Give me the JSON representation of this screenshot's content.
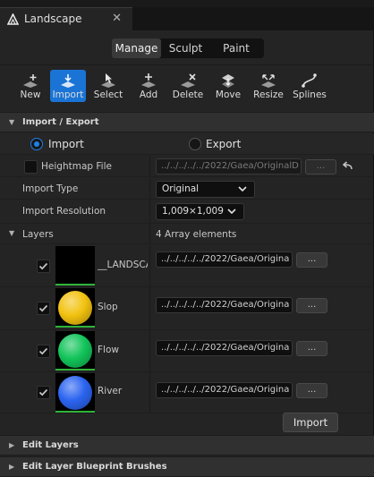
{
  "tab": {
    "title": "Landscape",
    "close": "✕",
    "icon": "unreal-logo-icon"
  },
  "modes": {
    "manage": "Manage",
    "sculpt": "Sculpt",
    "paint": "Paint",
    "selected": "Manage"
  },
  "tools": [
    {
      "label": "New",
      "icon": "new-icon"
    },
    {
      "label": "Import",
      "icon": "import-icon",
      "active": true
    },
    {
      "label": "Select",
      "icon": "select-icon"
    },
    {
      "label": "Add",
      "icon": "add-icon"
    },
    {
      "label": "Delete",
      "icon": "delete-icon"
    },
    {
      "label": "Move",
      "icon": "move-icon"
    },
    {
      "label": "Resize",
      "icon": "resize-icon"
    },
    {
      "label": "Splines",
      "icon": "splines-icon"
    }
  ],
  "import_export": {
    "title": "Import / Export",
    "import_option": "Import",
    "export_option": "Export",
    "selected": "Import",
    "heightmap_label": "Heightmap File",
    "heightmap_path": "../../../../../2022/Gaea/OriginalD",
    "browse": "...",
    "import_type_label": "Import Type",
    "import_type_value": "Original",
    "import_resolution_label": "Import Resolution",
    "import_resolution_value": "1,009×1,009"
  },
  "layers": {
    "title": "Layers",
    "count": "4 Array elements",
    "items": [
      {
        "name": "__LANDSCA",
        "path": "../../../../../2022/Gaea/Origina",
        "browse": "...",
        "checked": true,
        "color": "#000000"
      },
      {
        "name": "Slop",
        "path": "../../../../../2022/Gaea/Origina",
        "browse": "...",
        "checked": true,
        "color": "#f2c20f"
      },
      {
        "name": "Flow",
        "path": "../../../../../2022/Gaea/Origina",
        "browse": "...",
        "checked": true,
        "color": "#12c45a"
      },
      {
        "name": "River",
        "path": "../../../../../2022/Gaea/Origina",
        "browse": "...",
        "checked": true,
        "color": "#2b64f0"
      }
    ]
  },
  "import_button": "Import",
  "edit_layers": "Edit Layers",
  "edit_blueprint": "Edit Layer Blueprint Brushes",
  "colors": {
    "accent": "#1a74d6",
    "layer_strip": "#2fb43a"
  }
}
